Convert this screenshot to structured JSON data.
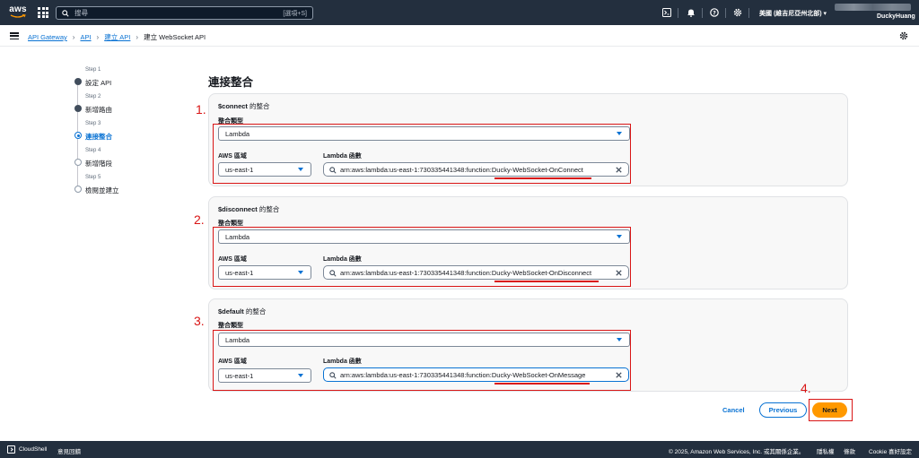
{
  "topnav": {
    "logo": "aws",
    "search_placeholder": "搜尋",
    "search_shortcut": "[選項+S]",
    "region": "美國 (維吉尼亞州北部)",
    "account_name": "DuckyHuang"
  },
  "breadcrumb": {
    "items": [
      "API Gateway",
      "API",
      "建立 API"
    ],
    "current": "建立 WebSocket API"
  },
  "steps": [
    {
      "number": "Step 1",
      "label": "設定 API",
      "state": "done"
    },
    {
      "number": "Step 2",
      "label": "新增路由",
      "state": "done"
    },
    {
      "number": "Step 3",
      "label": "連接整合",
      "state": "current"
    },
    {
      "number": "Step 4",
      "label": "新增階段",
      "state": "todo"
    },
    {
      "number": "Step 5",
      "label": "檢閱並建立",
      "state": "todo"
    }
  ],
  "page_title": "連接整合",
  "integrations": [
    {
      "route": "$connect",
      "suffix": " 的整合",
      "type_label": "整合類型",
      "type_value": "Lambda",
      "region_label": "AWS 區域",
      "region_value": "us-east-1",
      "lambda_label": "Lambda 函數",
      "lambda_prefix": "arn:aws:lambda:us-east-1:730335441348:function:",
      "lambda_name": "Ducky-WebSocket-OnConnect",
      "annotation": "1."
    },
    {
      "route": "$disconnect",
      "suffix": " 的整合",
      "type_label": "整合類型",
      "type_value": "Lambda",
      "region_label": "AWS 區域",
      "region_value": "us-east-1",
      "lambda_label": "Lambda 函數",
      "lambda_prefix": "arn:aws:lambda:us-east-1:730335441348:function:",
      "lambda_name": "Ducky-WebSocket-OnDisconnect",
      "annotation": "2."
    },
    {
      "route": "$default",
      "suffix": " 的整合",
      "type_label": "整合類型",
      "type_value": "Lambda",
      "region_label": "AWS 區域",
      "region_value": "us-east-1",
      "lambda_label": "Lambda 函數",
      "lambda_prefix": "arn:aws:lambda:us-east-1:730335441348:function:",
      "lambda_name": "Ducky-WebSocket-OnMessage",
      "annotation": "3."
    }
  ],
  "actions": {
    "cancel": "Cancel",
    "previous": "Previous",
    "next": "Next",
    "annotation": "4."
  },
  "footer": {
    "cloudshell": "CloudShell",
    "feedback": "意見回饋",
    "copyright": "© 2025, Amazon Web Services, Inc. 或其關係企業。",
    "privacy": "隱私權",
    "terms": "條款",
    "cookie": "Cookie 喜好設定"
  },
  "colors": {
    "nav_bg": "#232f3e",
    "link_blue": "#0972d3",
    "primary_orange": "#ff9900",
    "annotation_red": "#d91515"
  }
}
